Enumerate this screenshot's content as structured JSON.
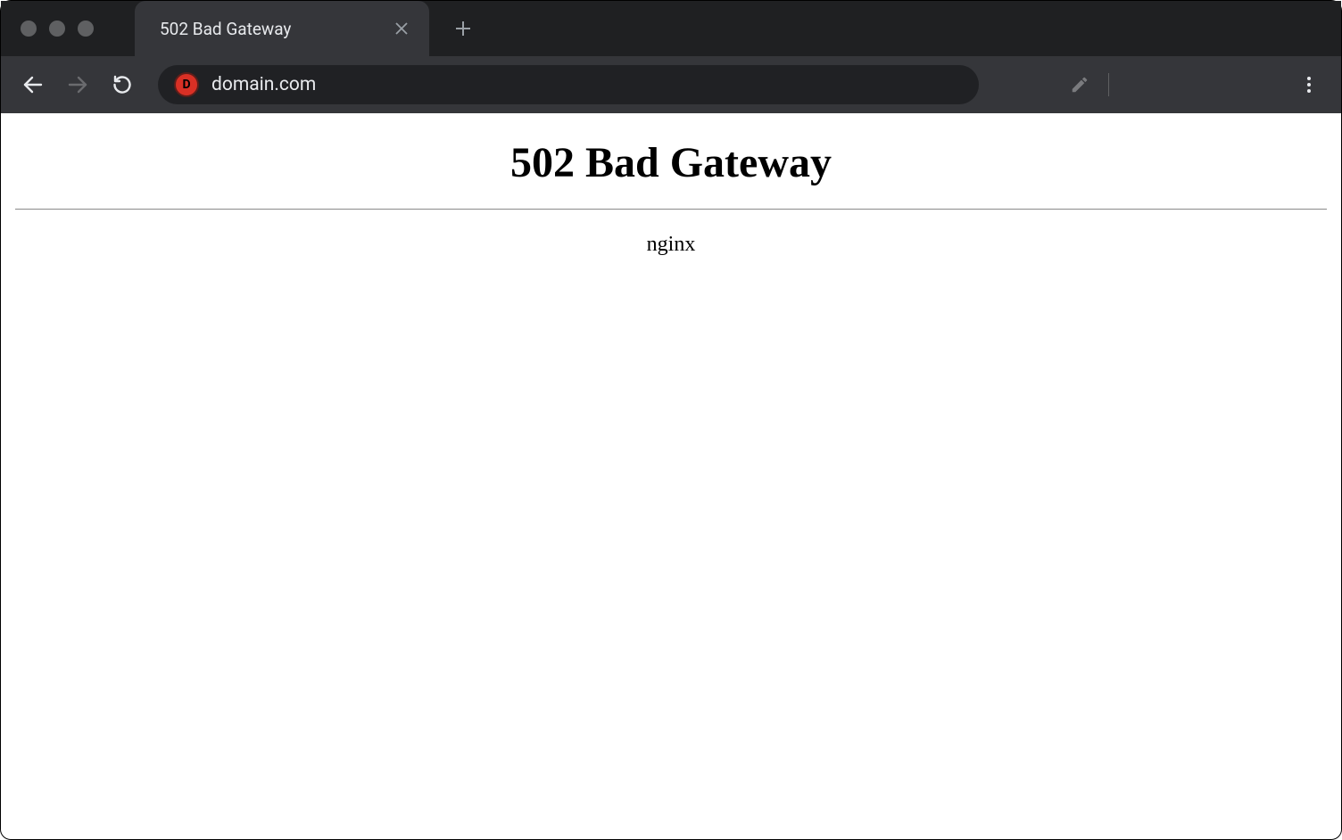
{
  "browser": {
    "tab": {
      "title": "502 Bad Gateway"
    },
    "url": "domain.com",
    "site_icon_letter": "D"
  },
  "page": {
    "heading": "502 Bad Gateway",
    "server": "nginx"
  }
}
